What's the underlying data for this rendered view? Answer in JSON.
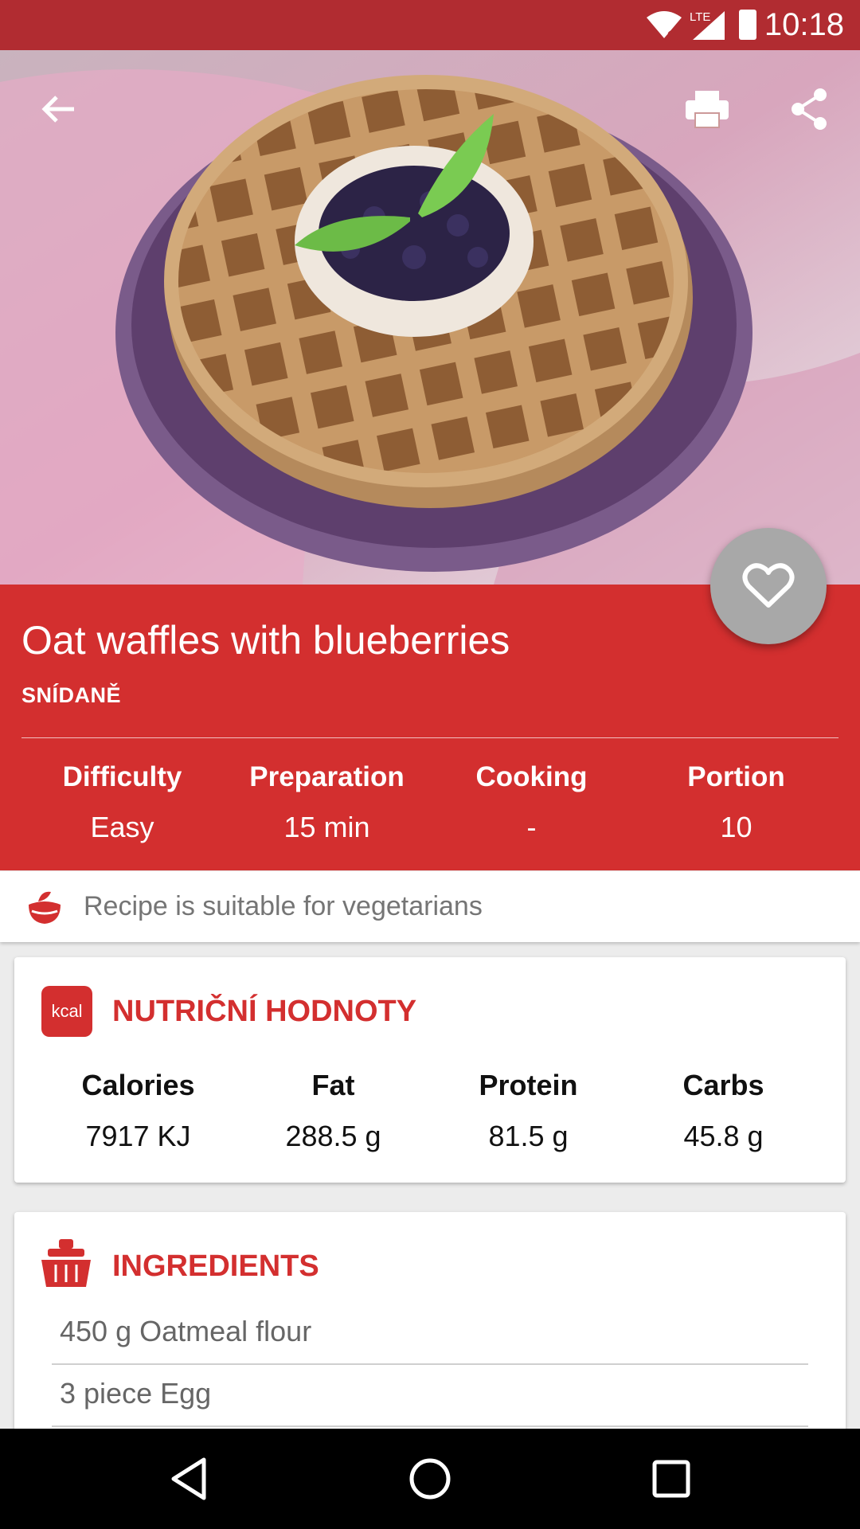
{
  "status_bar": {
    "time": "10:18",
    "network_label": "LTE",
    "icons": [
      "wifi-icon",
      "signal-icon",
      "battery-icon"
    ]
  },
  "toolbar": {
    "icons": [
      "back-arrow-icon",
      "print-icon",
      "share-icon"
    ]
  },
  "recipe": {
    "title": "Oat waffles with blueberries",
    "category": "SNÍDANĚ",
    "stats": [
      {
        "label": "Difficulty",
        "value": "Easy"
      },
      {
        "label": "Preparation",
        "value": "15 min"
      },
      {
        "label": "Cooking",
        "value": "-"
      },
      {
        "label": "Portion",
        "value": "10"
      }
    ]
  },
  "favorite": {
    "icon": "heart-outline-icon"
  },
  "vegetarian": {
    "icon": "vegetarian-bowl-icon",
    "text": "Recipe is suitable for vegetarians"
  },
  "nutrition": {
    "badge": "kcal",
    "title": "NUTRIČNÍ HODNOTY",
    "items": [
      {
        "label": "Calories",
        "value": "7917 KJ"
      },
      {
        "label": "Fat",
        "value": "288.5 g"
      },
      {
        "label": "Protein",
        "value": "81.5 g"
      },
      {
        "label": "Carbs",
        "value": "45.8 g"
      }
    ]
  },
  "ingredients": {
    "icon": "basket-icon",
    "title": "INGREDIENTS",
    "items": [
      "450 g Oatmeal flour",
      "3 piece Egg"
    ]
  },
  "nav_bar": {
    "icons": [
      "back-triangle-icon",
      "home-circle-icon",
      "recents-square-icon"
    ]
  },
  "colors": {
    "status_bar": "#b12c31",
    "accent": "#d32f2f",
    "fab": "#a8a8a8"
  }
}
